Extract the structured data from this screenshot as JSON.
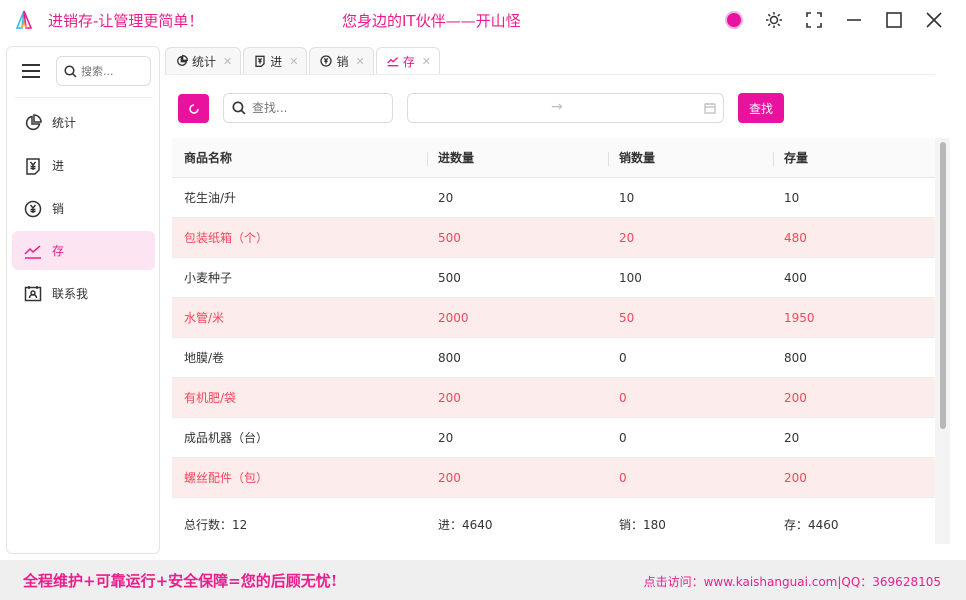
{
  "app": {
    "title": "进销存-让管理更简单！",
    "slogan": "您身边的IT伙伴——开山怪",
    "accent_color": "#e8129f"
  },
  "window_controls": [
    "color-theme",
    "brightness-icon",
    "fullscreen-icon",
    "minimize-icon",
    "maximize-icon",
    "close-icon"
  ],
  "sidebar": {
    "search_placeholder": "搜索...",
    "items": [
      {
        "label": "统计",
        "icon": "pie-chart-icon"
      },
      {
        "label": "进",
        "icon": "yen-doc-icon"
      },
      {
        "label": "销",
        "icon": "yen-circle-icon"
      },
      {
        "label": "存",
        "icon": "trend-icon",
        "active": true
      },
      {
        "label": "联系我",
        "icon": "contact-card-icon"
      }
    ]
  },
  "tabs": [
    {
      "label": "统计",
      "icon": "pie-chart-icon"
    },
    {
      "label": "进",
      "icon": "yen-doc-icon"
    },
    {
      "label": "销",
      "icon": "yen-circle-icon"
    },
    {
      "label": "存",
      "icon": "trend-icon",
      "active": true
    }
  ],
  "toolbar": {
    "search_placeholder": "查找...",
    "date_separator": "→",
    "find_label": "查找"
  },
  "table": {
    "columns": [
      "商品名称",
      "进数量",
      "销数量",
      "存量"
    ],
    "rows": [
      {
        "name": "花生油/升",
        "in": "20",
        "out": "10",
        "stock": "10",
        "warn": false
      },
      {
        "name": "包装纸箱（个）",
        "in": "500",
        "out": "20",
        "stock": "480",
        "warn": true
      },
      {
        "name": "小麦种子",
        "in": "500",
        "out": "100",
        "stock": "400",
        "warn": false
      },
      {
        "name": "水管/米",
        "in": "2000",
        "out": "50",
        "stock": "1950",
        "warn": true
      },
      {
        "name": "地膜/卷",
        "in": "800",
        "out": "0",
        "stock": "800",
        "warn": false
      },
      {
        "name": "有机肥/袋",
        "in": "200",
        "out": "0",
        "stock": "200",
        "warn": true
      },
      {
        "name": "成品机器（台）",
        "in": "20",
        "out": "0",
        "stock": "20",
        "warn": false
      },
      {
        "name": "螺丝配件（包）",
        "in": "200",
        "out": "0",
        "stock": "200",
        "warn": true
      }
    ],
    "summary": {
      "total_rows": "总行数：12",
      "total_in": "进：4640",
      "total_out": "销：180",
      "total_stock": "存：4460"
    }
  },
  "footer": {
    "left": "全程维护+可靠运行+安全保障=您的后顾无忧!",
    "right": "点击访问：www.kaishanguai.com|QQ：369628105"
  }
}
